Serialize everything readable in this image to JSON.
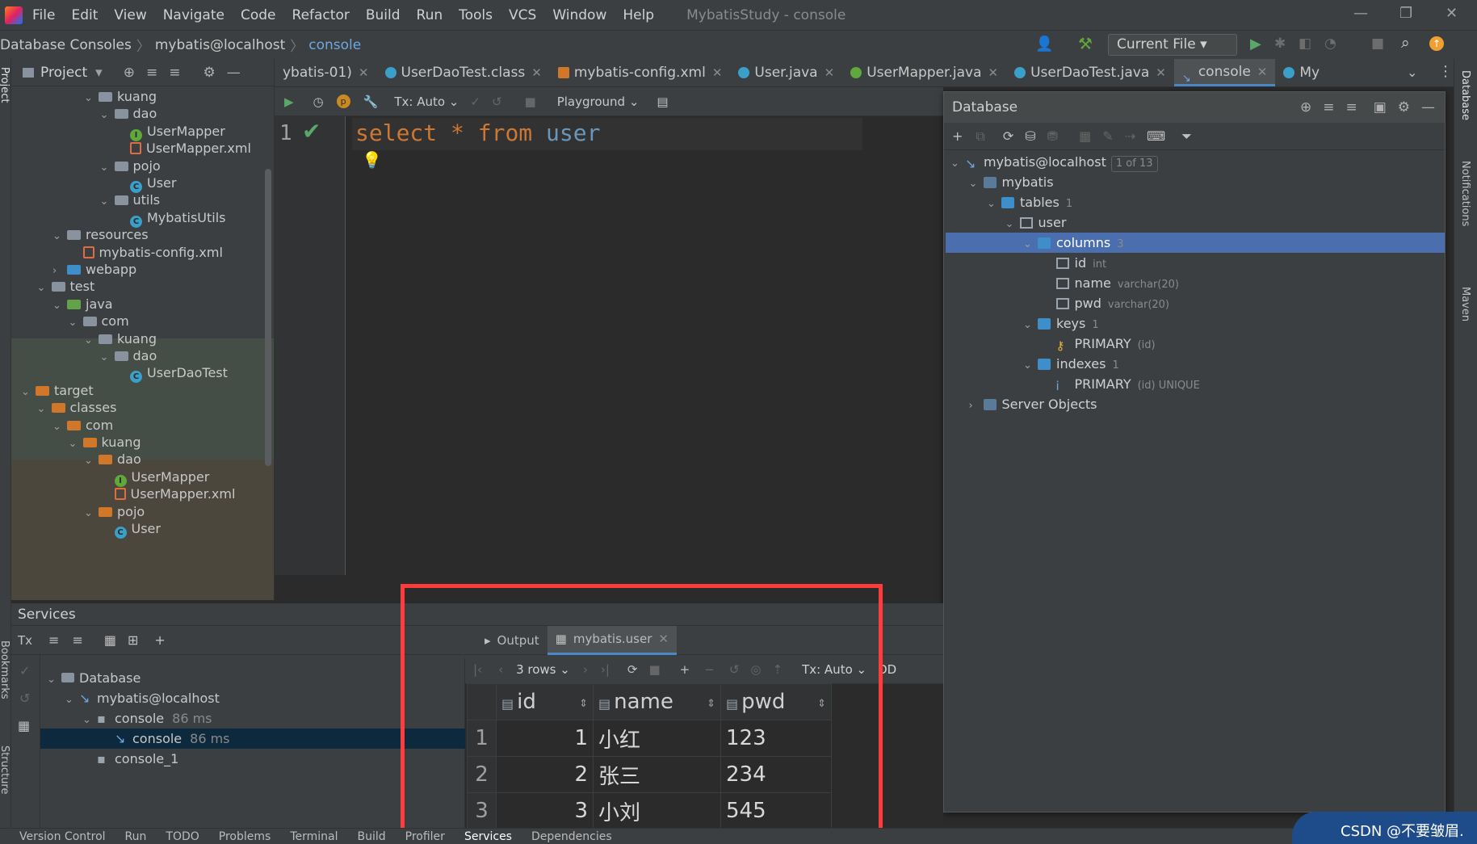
{
  "menu": {
    "items": [
      "File",
      "Edit",
      "View",
      "Navigate",
      "Code",
      "Refactor",
      "Build",
      "Run",
      "Tools",
      "VCS",
      "Window",
      "Help"
    ],
    "window_title": "MybatisStudy - console"
  },
  "navbar": {
    "crumbs": [
      "Database Consoles",
      "mybatis@localhost",
      "console"
    ],
    "run_config": "Current File"
  },
  "project": {
    "title": "Project",
    "tree": [
      {
        "label": "kuang",
        "indent": 4,
        "kind": "folder",
        "open": true
      },
      {
        "label": "dao",
        "indent": 5,
        "kind": "folder",
        "open": true
      },
      {
        "label": "UserMapper",
        "indent": 6,
        "kind": "interface"
      },
      {
        "label": "UserMapper.xml",
        "indent": 6,
        "kind": "xml"
      },
      {
        "label": "pojo",
        "indent": 5,
        "kind": "folder",
        "open": true
      },
      {
        "label": "User",
        "indent": 6,
        "kind": "class"
      },
      {
        "label": "utils",
        "indent": 5,
        "kind": "folder",
        "open": true
      },
      {
        "label": "MybatisUtils",
        "indent": 6,
        "kind": "class"
      },
      {
        "label": "resources",
        "indent": 2,
        "kind": "folder",
        "open": true
      },
      {
        "label": "mybatis-config.xml",
        "indent": 3,
        "kind": "xml"
      },
      {
        "label": "webapp",
        "indent": 2,
        "kind": "folder-blue",
        "open": false
      },
      {
        "label": "test",
        "indent": 1,
        "kind": "folder",
        "open": true
      },
      {
        "label": "java",
        "indent": 2,
        "kind": "folder-green",
        "open": true
      },
      {
        "label": "com",
        "indent": 3,
        "kind": "folder",
        "open": true
      },
      {
        "label": "kuang",
        "indent": 4,
        "kind": "folder",
        "open": true
      },
      {
        "label": "dao",
        "indent": 5,
        "kind": "folder",
        "open": true
      },
      {
        "label": "UserDaoTest",
        "indent": 6,
        "kind": "class"
      },
      {
        "label": "target",
        "indent": 0,
        "kind": "folder-orange",
        "open": true
      },
      {
        "label": "classes",
        "indent": 1,
        "kind": "folder-orange",
        "open": true
      },
      {
        "label": "com",
        "indent": 2,
        "kind": "folder-orange",
        "open": true
      },
      {
        "label": "kuang",
        "indent": 3,
        "kind": "folder-orange",
        "open": true
      },
      {
        "label": "dao",
        "indent": 4,
        "kind": "folder-orange",
        "open": true
      },
      {
        "label": "UserMapper",
        "indent": 5,
        "kind": "interface"
      },
      {
        "label": "UserMapper.xml",
        "indent": 5,
        "kind": "xml"
      },
      {
        "label": "pojo",
        "indent": 4,
        "kind": "folder-orange",
        "open": true
      },
      {
        "label": "User",
        "indent": 5,
        "kind": "class"
      }
    ]
  },
  "tabs": [
    {
      "label": "ybatis-01)",
      "icon": "none",
      "active": false
    },
    {
      "label": "UserDaoTest.class",
      "icon": "class",
      "active": false
    },
    {
      "label": "mybatis-config.xml",
      "icon": "xml",
      "active": false
    },
    {
      "label": "User.java",
      "icon": "class",
      "active": false
    },
    {
      "label": "UserMapper.java",
      "icon": "interface",
      "active": false
    },
    {
      "label": "UserDaoTest.java",
      "icon": "class",
      "active": false
    },
    {
      "label": "console",
      "icon": "console",
      "active": true
    },
    {
      "label": "My",
      "icon": "class",
      "active": false
    }
  ],
  "console_toolbar": {
    "tx": "Tx: Auto",
    "playground": "Playground"
  },
  "editor": {
    "line_number": "1",
    "sql": [
      {
        "text": "select",
        "color": "#cc7832"
      },
      {
        "text": " * ",
        "color": "#cc7832"
      },
      {
        "text": "from",
        "color": "#cc7832"
      },
      {
        "text": " user",
        "color": "#6897bb"
      }
    ]
  },
  "database": {
    "title": "Database",
    "tree": [
      {
        "label": "mybatis@localhost",
        "indent": 0,
        "badge": "1 of 13",
        "type": "",
        "open": true
      },
      {
        "label": "mybatis",
        "indent": 1,
        "badge": "",
        "type": "",
        "open": true
      },
      {
        "label": "tables",
        "indent": 2,
        "badge": "",
        "type": "1",
        "open": true
      },
      {
        "label": "user",
        "indent": 3,
        "badge": "",
        "type": "",
        "open": true
      },
      {
        "label": "columns",
        "indent": 4,
        "badge": "",
        "type": "3",
        "open": true,
        "selected": true
      },
      {
        "label": "id",
        "indent": 5,
        "badge": "",
        "type": "int"
      },
      {
        "label": "name",
        "indent": 5,
        "badge": "",
        "type": "varchar(20)"
      },
      {
        "label": "pwd",
        "indent": 5,
        "badge": "",
        "type": "varchar(20)"
      },
      {
        "label": "keys",
        "indent": 4,
        "badge": "",
        "type": "1",
        "open": true
      },
      {
        "label": "PRIMARY",
        "indent": 5,
        "badge": "",
        "type": "(id)"
      },
      {
        "label": "indexes",
        "indent": 4,
        "badge": "",
        "type": "1",
        "open": true
      },
      {
        "label": "PRIMARY",
        "indent": 5,
        "badge": "",
        "type": "(id) UNIQUE"
      },
      {
        "label": "Server Objects",
        "indent": 1,
        "badge": "",
        "type": "",
        "open": false
      }
    ]
  },
  "services": {
    "title": "Services",
    "tree": [
      {
        "label": "Database",
        "indent": 0,
        "time": ""
      },
      {
        "label": "mybatis@localhost",
        "indent": 1,
        "time": ""
      },
      {
        "label": "console",
        "indent": 2,
        "time": "86 ms"
      },
      {
        "label": "console",
        "indent": 3,
        "time": "86 ms",
        "selected": true
      },
      {
        "label": "console_1",
        "indent": 2,
        "time": ""
      }
    ]
  },
  "result": {
    "tabs": [
      "Output",
      "mybatis.user"
    ],
    "rows_label": "3 rows",
    "tx": "Tx: Auto",
    "ddl": "DD",
    "columns": [
      "id",
      "name",
      "pwd"
    ],
    "rows": [
      {
        "n": "1",
        "id": "1",
        "name": "小红",
        "pwd": "123"
      },
      {
        "n": "2",
        "id": "2",
        "name": "张三",
        "pwd": "234"
      },
      {
        "n": "3",
        "id": "3",
        "name": "小刘",
        "pwd": "545"
      }
    ]
  },
  "statusbar": [
    "Version Control",
    "Run",
    "TODO",
    "Problems",
    "Terminal",
    "Build",
    "Profiler",
    "Services",
    "Dependencies"
  ],
  "side_labels": {
    "left_top": "Project",
    "left_mid": "Bookmarks",
    "left_bottom": "Structure",
    "right": [
      "Database",
      "Notifications",
      "Maven"
    ]
  },
  "watermark": "CSDN @不要皱眉."
}
